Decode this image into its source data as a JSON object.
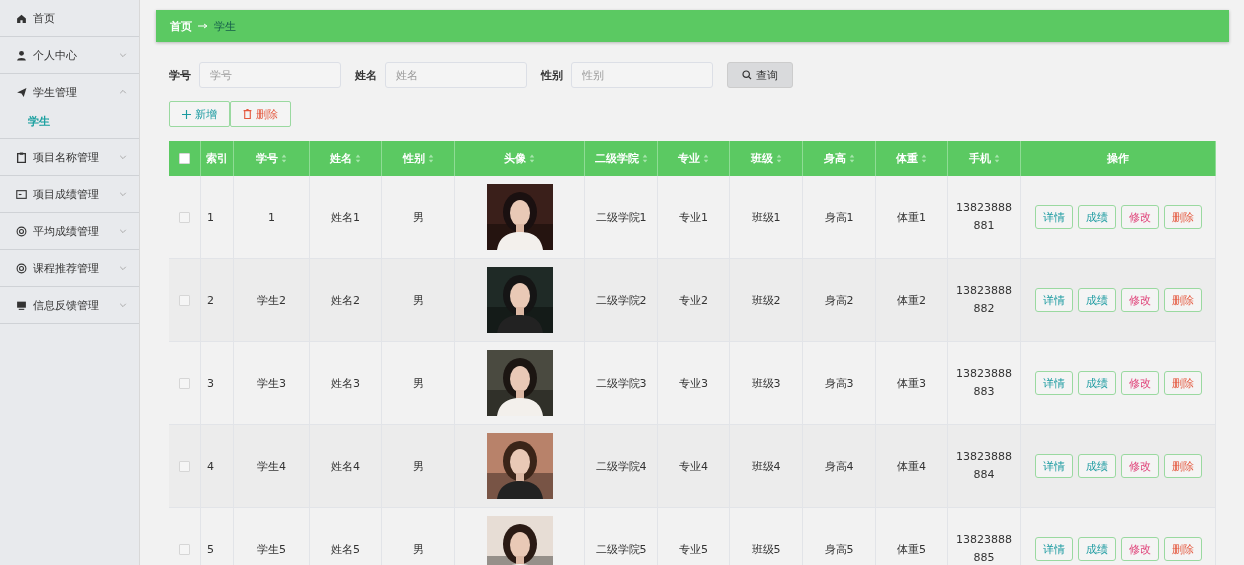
{
  "sidebar": {
    "items": [
      {
        "label": "首页"
      },
      {
        "label": "个人中心",
        "expanded": false
      },
      {
        "label": "学生管理",
        "expanded": true,
        "children": [
          {
            "label": "学生",
            "selected": true
          }
        ]
      },
      {
        "label": "项目名称管理",
        "expanded": false
      },
      {
        "label": "项目成绩管理",
        "expanded": false
      },
      {
        "label": "平均成绩管理",
        "expanded": false
      },
      {
        "label": "课程推荐管理",
        "expanded": false
      },
      {
        "label": "信息反馈管理",
        "expanded": false
      }
    ]
  },
  "breadcrumb": [
    "首页",
    "学生"
  ],
  "search": {
    "fields": [
      {
        "label": "学号",
        "placeholder": "学号"
      },
      {
        "label": "姓名",
        "placeholder": "姓名"
      },
      {
        "label": "性别",
        "placeholder": "性别"
      }
    ],
    "button": "查询"
  },
  "toolbar": [
    {
      "label": "新增",
      "kind": "add"
    },
    {
      "label": "删除",
      "kind": "delete"
    }
  ],
  "table": {
    "header_checked": false,
    "columns": [
      {
        "label": "索引",
        "sortable": false
      },
      {
        "label": "学号",
        "sortable": true
      },
      {
        "label": "姓名",
        "sortable": true
      },
      {
        "label": "性别",
        "sortable": true
      },
      {
        "label": "头像",
        "sortable": true
      },
      {
        "label": "二级学院",
        "sortable": true
      },
      {
        "label": "专业",
        "sortable": true
      },
      {
        "label": "班级",
        "sortable": true
      },
      {
        "label": "身高",
        "sortable": true
      },
      {
        "label": "体重",
        "sortable": true
      },
      {
        "label": "手机",
        "sortable": true
      },
      {
        "label": "操作",
        "sortable": false
      }
    ],
    "rows": [
      {
        "checked": false,
        "cells": [
          "1",
          "1",
          "姓名1",
          "男",
          "",
          "二级学院1",
          "专业1",
          "班级1",
          "身高1",
          "体重1",
          "13823888881"
        ],
        "photo": {
          "kind": "picture"
        },
        "actions": [
          {
            "label": "详情",
            "kind": "info"
          },
          {
            "label": "成绩",
            "kind": "info"
          },
          {
            "label": "修改",
            "kind": "edit"
          },
          {
            "label": "删除",
            "kind": "delete"
          }
        ]
      },
      {
        "checked": false,
        "cells": [
          "2",
          "学生2",
          "姓名2",
          "男",
          "",
          "二级学院2",
          "专业2",
          "班级2",
          "身高2",
          "体重2",
          "13823888882"
        ],
        "photo": {
          "kind": "picture"
        },
        "actions": [
          {
            "label": "详情",
            "kind": "info"
          },
          {
            "label": "成绩",
            "kind": "info"
          },
          {
            "label": "修改",
            "kind": "edit"
          },
          {
            "label": "删除",
            "kind": "delete"
          }
        ]
      },
      {
        "checked": false,
        "cells": [
          "3",
          "学生3",
          "姓名3",
          "男",
          "",
          "二级学院3",
          "专业3",
          "班级3",
          "身高3",
          "体重3",
          "13823888883"
        ],
        "photo": {
          "kind": "picture"
        },
        "actions": [
          {
            "label": "详情",
            "kind": "info"
          },
          {
            "label": "成绩",
            "kind": "info"
          },
          {
            "label": "修改",
            "kind": "edit"
          },
          {
            "label": "删除",
            "kind": "delete"
          }
        ]
      },
      {
        "checked": false,
        "cells": [
          "4",
          "学生4",
          "姓名4",
          "男",
          "",
          "二级学院4",
          "专业4",
          "班级4",
          "身高4",
          "体重4",
          "13823888884"
        ],
        "photo": {
          "kind": "picture"
        },
        "actions": [
          {
            "label": "详情",
            "kind": "info"
          },
          {
            "label": "成绩",
            "kind": "info"
          },
          {
            "label": "修改",
            "kind": "edit"
          },
          {
            "label": "删除",
            "kind": "delete"
          }
        ]
      },
      {
        "checked": false,
        "cells": [
          "5",
          "学生5",
          "姓名5",
          "男",
          "",
          "二级学院5",
          "专业5",
          "班级5",
          "身高5",
          "体重5",
          "13823888885"
        ],
        "photo": {
          "kind": "picture"
        },
        "actions": [
          {
            "label": "详情",
            "kind": "info"
          },
          {
            "label": "成绩",
            "kind": "info"
          },
          {
            "label": "修改",
            "kind": "edit"
          },
          {
            "label": "删除",
            "kind": "delete"
          }
        ]
      }
    ]
  }
}
